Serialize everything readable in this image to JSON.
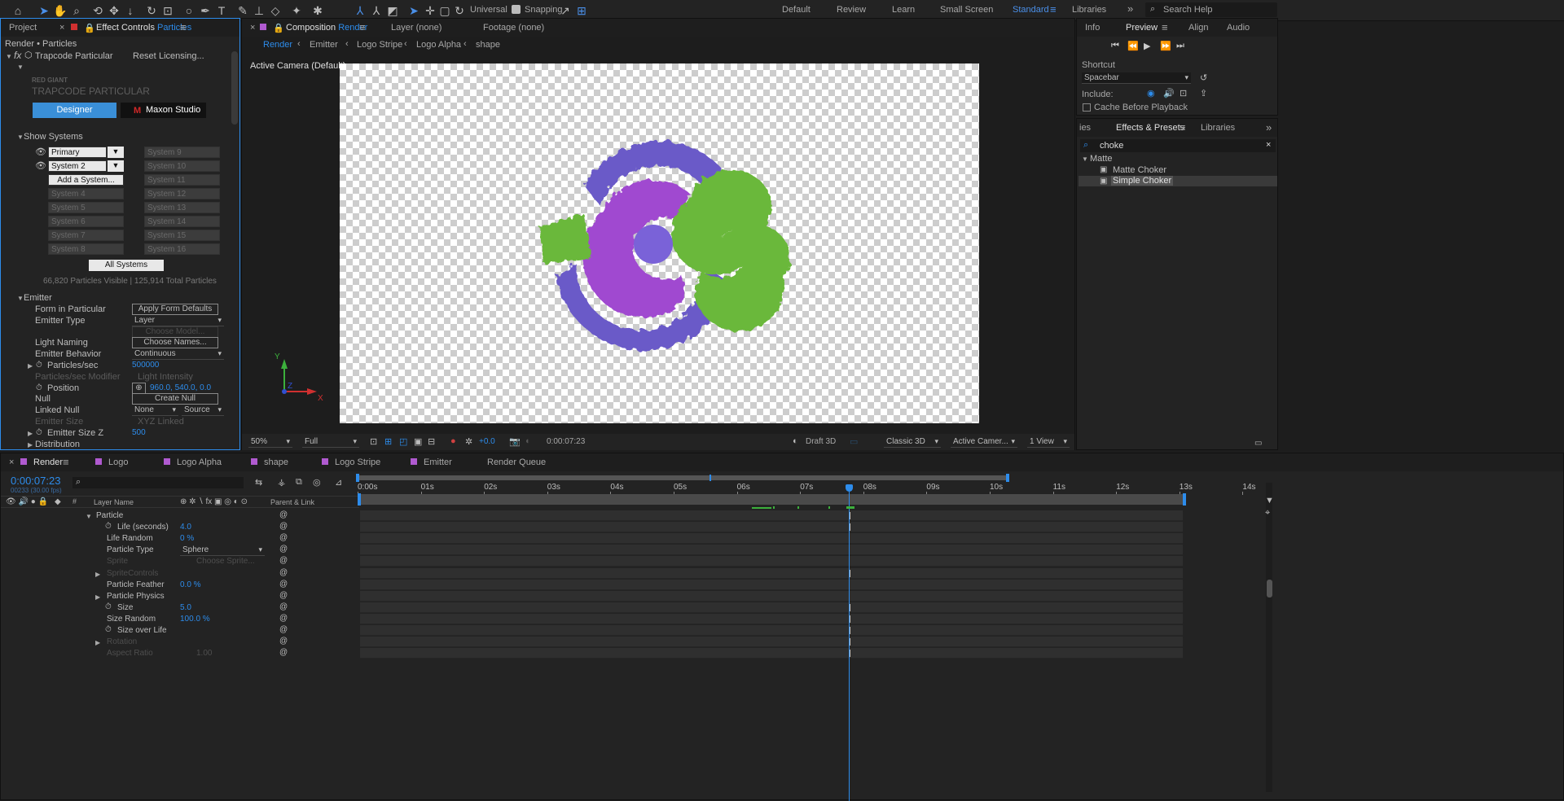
{
  "workspaces": [
    "Default",
    "Review",
    "Learn",
    "Small Screen",
    "Standard",
    "Libraries"
  ],
  "toolbar": {
    "universal": "Universal",
    "snapping": "Snapping",
    "search_help": "Search Help"
  },
  "project_panel": {
    "tab_project": "Project",
    "tab_effect_controls": "Effect Controls",
    "effect_target": "Particles",
    "breadcrumb": "Render • Particles",
    "effect_name": "Trapcode Particular",
    "reset": "Reset",
    "licensing": "Licensing...",
    "brand_small": "RED GIANT",
    "brand_big": "TRAPCODE PARTICULAR",
    "designer": "Designer",
    "maxon_studio": "Maxon Studio",
    "show_systems": "Show Systems",
    "systems_left": [
      "Primary System",
      "System 2",
      "Add a System...",
      "System 4",
      "System 5",
      "System 6",
      "System 7",
      "System 8"
    ],
    "systems_right": [
      "System 9",
      "System 10",
      "System 11",
      "System 12",
      "System 13",
      "System 14",
      "System 15",
      "System 16"
    ],
    "all_systems": "All Systems",
    "particle_count": "66,820 Particles Visible  |  125,914 Total Particles",
    "emitter": "Emitter",
    "props": [
      {
        "label": "Form in Particular",
        "kind": "button",
        "value": "Apply Form Defaults"
      },
      {
        "label": "Emitter Type",
        "kind": "dropdown",
        "value": "Layer"
      },
      {
        "label": "",
        "kind": "button-dis",
        "value": "Choose Model..."
      },
      {
        "label": "Light Naming",
        "kind": "button",
        "value": "Choose Names..."
      },
      {
        "label": "Emitter Behavior",
        "kind": "dropdown",
        "value": "Continuous"
      },
      {
        "label": "Particles/sec",
        "kind": "value",
        "value": "500000"
      },
      {
        "label": "Particles/sec Modifier",
        "kind": "dim",
        "value": "Light Intensity"
      },
      {
        "label": "Position",
        "kind": "value",
        "value": "960.0, 540.0, 0.0"
      },
      {
        "label": "Null",
        "kind": "button",
        "value": "Create Null"
      },
      {
        "label": "Linked Null",
        "kind": "dual",
        "value": "None",
        "value2": "Source"
      },
      {
        "label": "Emitter Size",
        "kind": "dim",
        "value": "XYZ Linked"
      },
      {
        "label": "Emitter Size Z",
        "kind": "value",
        "value": "500"
      },
      {
        "label": "Distribution",
        "kind": "none",
        "value": ""
      }
    ]
  },
  "composition": {
    "tab_title": "Composition",
    "comp_name": "Render",
    "layer_tab": "Layer  (none)",
    "footage_tab": "Footage  (none)",
    "breadcrumbs": [
      "Render",
      "Emitter",
      "Logo Stripe",
      "Logo Alpha",
      "shape"
    ],
    "camera_label": "Active Camera (Default)",
    "axis_y": "Y",
    "axis_x": "X",
    "axis_z": "Z",
    "zoom": "50%",
    "resolution": "Full",
    "exposure": "+0.0",
    "timecode": "0:00:07:23",
    "draft3d": "Draft 3D",
    "renderer": "Classic 3D",
    "camera_select": "Active Camer...",
    "view_select": "1 View"
  },
  "preview": {
    "tabs": [
      "Info",
      "Preview",
      "Align",
      "Audio"
    ],
    "shortcut_label": "Shortcut",
    "shortcut_value": "Spacebar",
    "include_label": "Include:",
    "cache_label": "Cache Before Playback"
  },
  "effects_presets": {
    "tabs": [
      "ies",
      "Effects & Presets",
      "Libraries"
    ],
    "search_value": "choke",
    "category": "Matte",
    "items": [
      "Matte Choker",
      "Simple Choker"
    ]
  },
  "timeline": {
    "tabs": [
      "Render",
      "Logo",
      "Logo Alpha",
      "shape",
      "Logo Stripe",
      "Emitter",
      "Render Queue"
    ],
    "timecode": "0:00:07:23",
    "frame_info": "00233 (30.00 fps)",
    "col_layer_name": "Layer Name",
    "col_parent": "Parent & Link",
    "ruler": [
      "0:00s",
      "01s",
      "02s",
      "03s",
      "04s",
      "05s",
      "06s",
      "07s",
      "08s",
      "09s",
      "10s",
      "11s",
      "12s",
      "13s",
      "14s"
    ],
    "rows": [
      {
        "label": "Particle",
        "indent": 0,
        "twirl": true,
        "stopwatch": false,
        "value": "",
        "dim": false
      },
      {
        "label": "Life (seconds)",
        "indent": 1,
        "twirl": false,
        "stopwatch": true,
        "value": "4.0",
        "dim": false
      },
      {
        "label": "Life Random",
        "indent": 1,
        "twirl": false,
        "stopwatch": false,
        "value": "0 %",
        "dim": false
      },
      {
        "label": "Particle Type",
        "indent": 1,
        "twirl": false,
        "stopwatch": false,
        "value": "Sphere",
        "dim": false,
        "dropdown": true
      },
      {
        "label": "Sprite",
        "indent": 1,
        "twirl": false,
        "stopwatch": false,
        "value": "Choose Sprite...",
        "dim": true
      },
      {
        "label": "SpriteControls",
        "indent": 1,
        "twirl": true,
        "stopwatch": false,
        "value": "",
        "dim": true
      },
      {
        "label": "Particle Feather",
        "indent": 1,
        "twirl": false,
        "stopwatch": false,
        "value": "0.0 %",
        "dim": false
      },
      {
        "label": "Particle Physics",
        "indent": 1,
        "twirl": true,
        "stopwatch": false,
        "value": "",
        "dim": false
      },
      {
        "label": "Size",
        "indent": 1,
        "twirl": false,
        "stopwatch": true,
        "value": "5.0",
        "dim": false
      },
      {
        "label": "Size Random",
        "indent": 1,
        "twirl": false,
        "stopwatch": false,
        "value": "100.0 %",
        "dim": false
      },
      {
        "label": "Size over Life",
        "indent": 1,
        "twirl": false,
        "stopwatch": true,
        "value": "",
        "dim": false
      },
      {
        "label": "Rotation",
        "indent": 1,
        "twirl": true,
        "stopwatch": false,
        "value": "",
        "dim": true
      },
      {
        "label": "Aspect Ratio",
        "indent": 1,
        "twirl": false,
        "stopwatch": false,
        "value": "1.00",
        "dim": true
      }
    ]
  }
}
